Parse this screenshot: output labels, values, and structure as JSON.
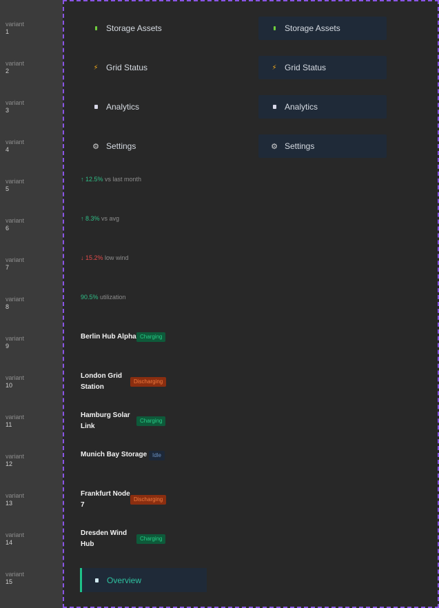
{
  "variants": [
    {
      "k": "variant",
      "n": "1"
    },
    {
      "k": "variant",
      "n": "2"
    },
    {
      "k": "variant",
      "n": "3"
    },
    {
      "k": "variant",
      "n": "4"
    },
    {
      "k": "variant",
      "n": "5"
    },
    {
      "k": "variant",
      "n": "6"
    },
    {
      "k": "variant",
      "n": "7"
    },
    {
      "k": "variant",
      "n": "8"
    },
    {
      "k": "variant",
      "n": "9"
    },
    {
      "k": "variant",
      "n": "10"
    },
    {
      "k": "variant",
      "n": "11"
    },
    {
      "k": "variant",
      "n": "12"
    },
    {
      "k": "variant",
      "n": "13"
    },
    {
      "k": "variant",
      "n": "14"
    },
    {
      "k": "variant",
      "n": "15"
    }
  ],
  "nav": {
    "storage": "Storage Assets",
    "grid": "Grid Status",
    "analytics": "Analytics",
    "settings": "Settings",
    "overview": "Overview"
  },
  "trends": [
    {
      "value": "↑ 12.5%",
      "note": "vs last month"
    },
    {
      "value": "↑ 8.3%",
      "note": "vs avg"
    },
    {
      "value": "↓ 15.2%",
      "note": "low wind"
    },
    {
      "value": "90.5%",
      "note": "utilization"
    }
  ],
  "sites": [
    {
      "name": "Berlin Hub Alpha",
      "status": "Charging"
    },
    {
      "name": "London Grid Station",
      "status": "Discharging"
    },
    {
      "name": "Hamburg Solar Link",
      "status": "Charging"
    },
    {
      "name": "Munich Bay Storage",
      "status": "Idle"
    },
    {
      "name": "Frankfurt Node 7",
      "status": "Discharging"
    },
    {
      "name": "Dresden Wind Hub",
      "status": "Charging"
    }
  ],
  "colors": {
    "accent_green": "#2fbf87",
    "accent_red": "#e04a4a",
    "selection_outline": "#8a55e6",
    "nav_filled_bg": "#1f2a38"
  }
}
